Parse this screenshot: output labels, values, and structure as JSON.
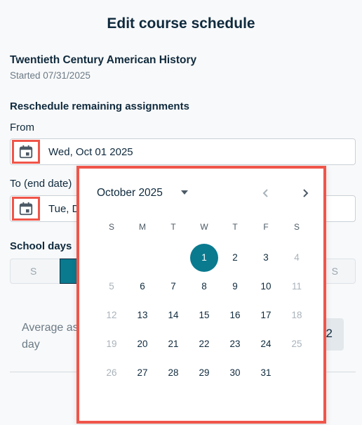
{
  "header": {
    "title": "Edit course schedule"
  },
  "course": {
    "name": "Twentieth Century American History",
    "started": "Started 07/31/2025"
  },
  "reschedule": {
    "heading": "Reschedule remaining assignments",
    "from_label": "From",
    "from_value": "Wed, Oct 01 2025",
    "to_label": "To (end date)",
    "to_value": "Tue, D"
  },
  "school_days": {
    "label": "School days",
    "first": "S",
    "last": "S"
  },
  "average": {
    "label_line1": "Average as",
    "label_line2": "day",
    "value": "2"
  },
  "calendar": {
    "month": "October 2025",
    "weekdays": [
      "S",
      "M",
      "T",
      "W",
      "T",
      "F",
      "S"
    ],
    "selected_day": 1,
    "weeks": [
      [
        "",
        "",
        "",
        "1",
        "2",
        "3",
        "4"
      ],
      [
        "5",
        "6",
        "7",
        "8",
        "9",
        "10",
        "11"
      ],
      [
        "12",
        "13",
        "14",
        "15",
        "16",
        "17",
        "18"
      ],
      [
        "19",
        "20",
        "21",
        "22",
        "23",
        "24",
        "25"
      ],
      [
        "26",
        "27",
        "28",
        "29",
        "30",
        "31",
        ""
      ]
    ]
  },
  "colors": {
    "accent": "#0a7a8f",
    "highlight": "#f0554a",
    "text": "#0f2a3d"
  }
}
